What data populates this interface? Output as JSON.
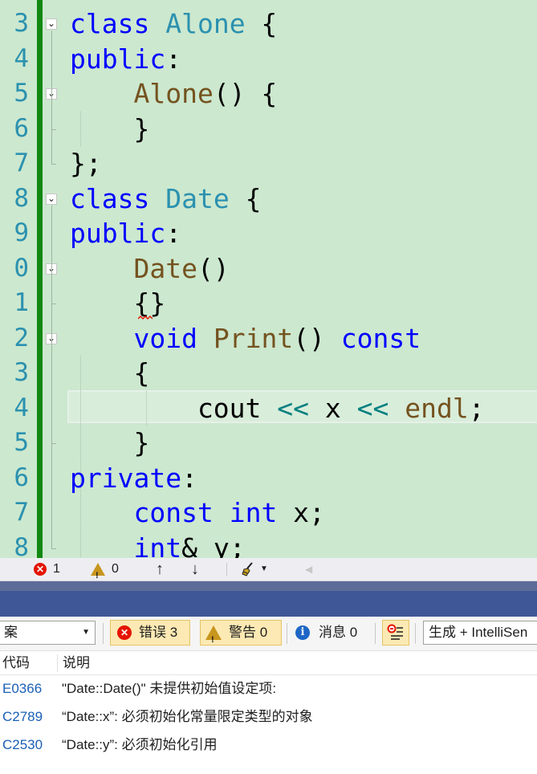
{
  "editor": {
    "line_numbers": [
      "3",
      "4",
      "5",
      "6",
      "7",
      "8",
      "9",
      "0",
      "1",
      "2",
      "3",
      "4",
      "5",
      "6",
      "7",
      "8"
    ],
    "lines": [
      [
        {
          "t": "class ",
          "c": "kw"
        },
        {
          "t": "Alone",
          "c": "ty"
        },
        {
          "t": " {",
          "c": ""
        }
      ],
      [
        {
          "t": "public",
          "c": "kw"
        },
        {
          "t": ":",
          "c": ""
        }
      ],
      [
        {
          "t": "    ",
          "c": ""
        },
        {
          "t": "Alone",
          "c": "fn"
        },
        {
          "t": "() {",
          "c": ""
        }
      ],
      [
        {
          "t": "    }",
          "c": ""
        }
      ],
      [
        {
          "t": "};",
          "c": ""
        }
      ],
      [
        {
          "t": "class ",
          "c": "kw"
        },
        {
          "t": "Date",
          "c": "ty"
        },
        {
          "t": " {",
          "c": ""
        }
      ],
      [
        {
          "t": "public",
          "c": "kw"
        },
        {
          "t": ":",
          "c": ""
        }
      ],
      [
        {
          "t": "    ",
          "c": ""
        },
        {
          "t": "Date",
          "c": "fn"
        },
        {
          "t": "()",
          "c": ""
        }
      ],
      [
        {
          "t": "    {}",
          "c": ""
        }
      ],
      [
        {
          "t": "    ",
          "c": ""
        },
        {
          "t": "void",
          "c": "kw"
        },
        {
          "t": " ",
          "c": ""
        },
        {
          "t": "Print",
          "c": "fn"
        },
        {
          "t": "() ",
          "c": ""
        },
        {
          "t": "const",
          "c": "kw"
        }
      ],
      [
        {
          "t": "    {",
          "c": ""
        }
      ],
      [
        {
          "t": "        cout ",
          "c": ""
        },
        {
          "t": "<<",
          "c": "op"
        },
        {
          "t": " x ",
          "c": ""
        },
        {
          "t": "<<",
          "c": "op"
        },
        {
          "t": " ",
          "c": ""
        },
        {
          "t": "endl",
          "c": "fn"
        },
        {
          "t": ";",
          "c": ""
        }
      ],
      [
        {
          "t": "    }",
          "c": ""
        }
      ],
      [
        {
          "t": "private",
          "c": "kw"
        },
        {
          "t": ":",
          "c": ""
        }
      ],
      [
        {
          "t": "    ",
          "c": ""
        },
        {
          "t": "const",
          "c": "kw"
        },
        {
          "t": " ",
          "c": ""
        },
        {
          "t": "int",
          "c": "kw"
        },
        {
          "t": " x;",
          "c": ""
        }
      ],
      [
        {
          "t": "    ",
          "c": ""
        },
        {
          "t": "int",
          "c": "kw"
        },
        {
          "t": "& y;",
          "c": ""
        }
      ]
    ],
    "fold_lines": [
      0,
      2,
      5,
      7,
      9
    ]
  },
  "statusbar": {
    "errors": "1",
    "warnings": "0"
  },
  "toolbar": {
    "scope_value": "案",
    "errors_label": "错误 3",
    "warnings_label": "警告 0",
    "messages_label": "消息 0",
    "source_value": "生成 + IntelliSen"
  },
  "error_list": {
    "columns": [
      "代码",
      "说明"
    ],
    "rows": [
      {
        "code": "E0366",
        "description": "\"Date::Date()\" 未提供初始值设定项:"
      },
      {
        "code": "C2789",
        "description": "“Date::x”: 必须初始化常量限定类型的对象"
      },
      {
        "code": "C2530",
        "description": "“Date::y”: 必须初始化引用"
      }
    ]
  },
  "colors": {
    "editor_bg": "#cce8cf",
    "change_bar": "#108810",
    "keyword": "#0000ff",
    "type": "#2b91af",
    "function": "#74531f",
    "operator": "#008080",
    "panel_title": "#3f5796"
  }
}
